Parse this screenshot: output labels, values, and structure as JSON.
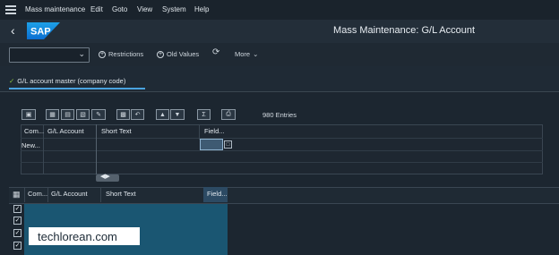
{
  "menu": {
    "items": [
      "Mass maintenance",
      "Edit",
      "Goto",
      "View",
      "System",
      "Help"
    ]
  },
  "header": {
    "title": "Mass Maintenance: G/L Account",
    "logo_text": "SAP"
  },
  "toolbar": {
    "restrictions": "Restrictions",
    "old_values": "Old Values",
    "more": "More"
  },
  "tab": {
    "label": "G/L account master (company code)"
  },
  "grid1": {
    "entries": "980 Entries",
    "columns": [
      "Com...",
      "G/L Account",
      "Short Text",
      "Field..."
    ],
    "row": [
      "New..."
    ]
  },
  "grid2": {
    "columns": [
      "Com...",
      "G/L Account",
      "Short Text",
      "Field..."
    ]
  },
  "watermark": {
    "text": "techlorean.com"
  },
  "colors": {
    "accent": "#4aa3df",
    "check": "#8cc63f",
    "shell": "#1c2630"
  }
}
